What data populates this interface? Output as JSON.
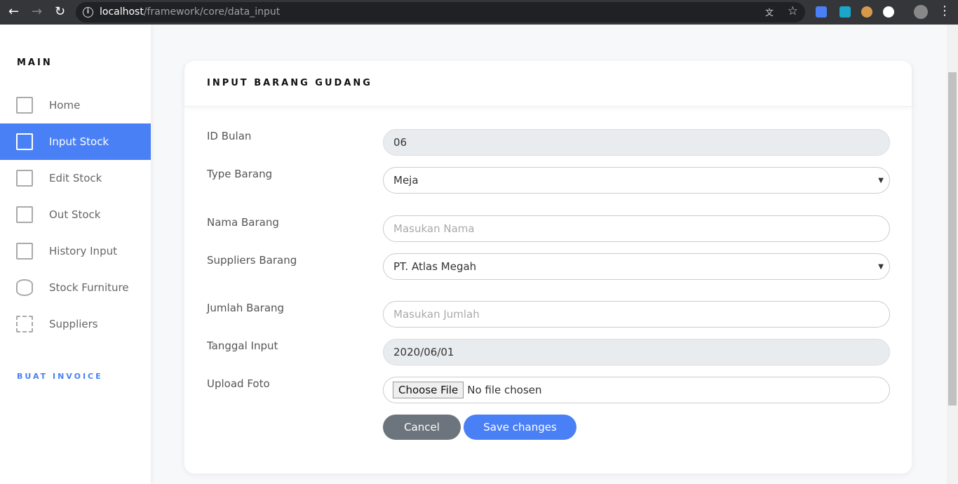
{
  "browser": {
    "url_host": "localhost",
    "url_path": "/framework/core/data_input"
  },
  "sidebar": {
    "section_main": "MAIN",
    "items": [
      {
        "label": "Home",
        "icon": "home-icon"
      },
      {
        "label": "Input Stock",
        "icon": "document-icon",
        "active": true
      },
      {
        "label": "Edit Stock",
        "icon": "clipboard-icon"
      },
      {
        "label": "Out Stock",
        "icon": "exit-icon"
      },
      {
        "label": "History Input",
        "icon": "table-icon"
      },
      {
        "label": "Stock Furniture",
        "icon": "database-icon"
      },
      {
        "label": "Suppliers",
        "icon": "grid-icon"
      }
    ],
    "section_invoice": "BUAT INVOICE"
  },
  "form": {
    "title": "INPUT BARANG GUDANG",
    "fields": [
      {
        "label": "ID Bulan",
        "value": "06"
      },
      {
        "label": "Type Barang",
        "value": "Meja"
      },
      {
        "label": "Nama Barang",
        "placeholder": "Masukan Nama"
      },
      {
        "label": "Suppliers Barang",
        "value": "PT. Atlas Megah"
      },
      {
        "label": "Jumlah Barang",
        "placeholder": "Masukan Jumlah"
      },
      {
        "label": "Tanggal Input",
        "value": "2020/06/01"
      },
      {
        "label": "Upload Foto",
        "button": "Choose File",
        "status": "No file chosen"
      }
    ],
    "cancel": "Cancel",
    "save": "Save changes"
  },
  "colors": {
    "accent": "#4a80f5",
    "cancel": "#6c757d"
  }
}
